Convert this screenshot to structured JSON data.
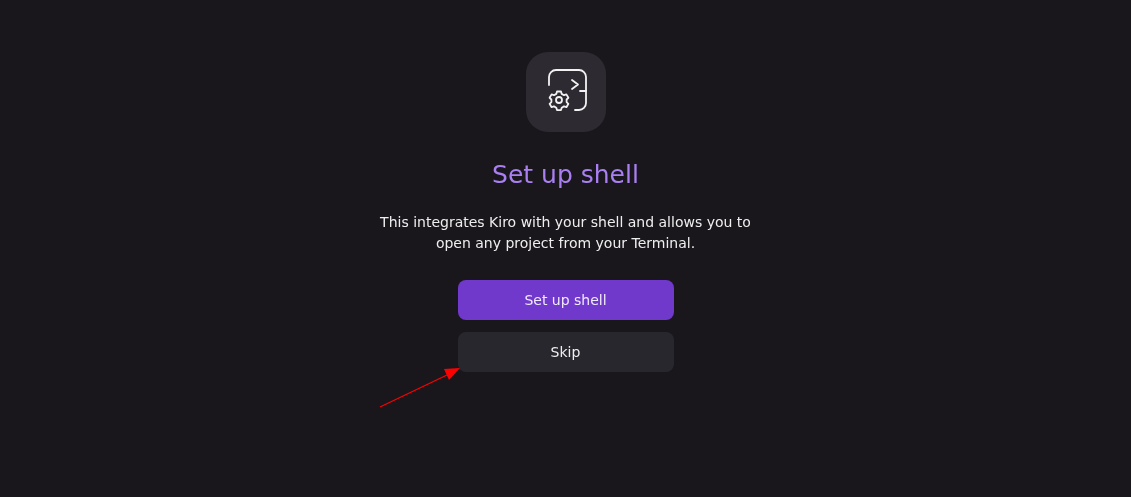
{
  "title": "Set up shell",
  "description": "This integrates Kiro with your shell and allows you to open any project from your Terminal.",
  "buttons": [
    {
      "label": "Set up shell",
      "kind": "primary"
    },
    {
      "label": "Skip",
      "kind": "secondary"
    }
  ],
  "annotation": {
    "kind": "arrow",
    "color": "#ff0000"
  }
}
